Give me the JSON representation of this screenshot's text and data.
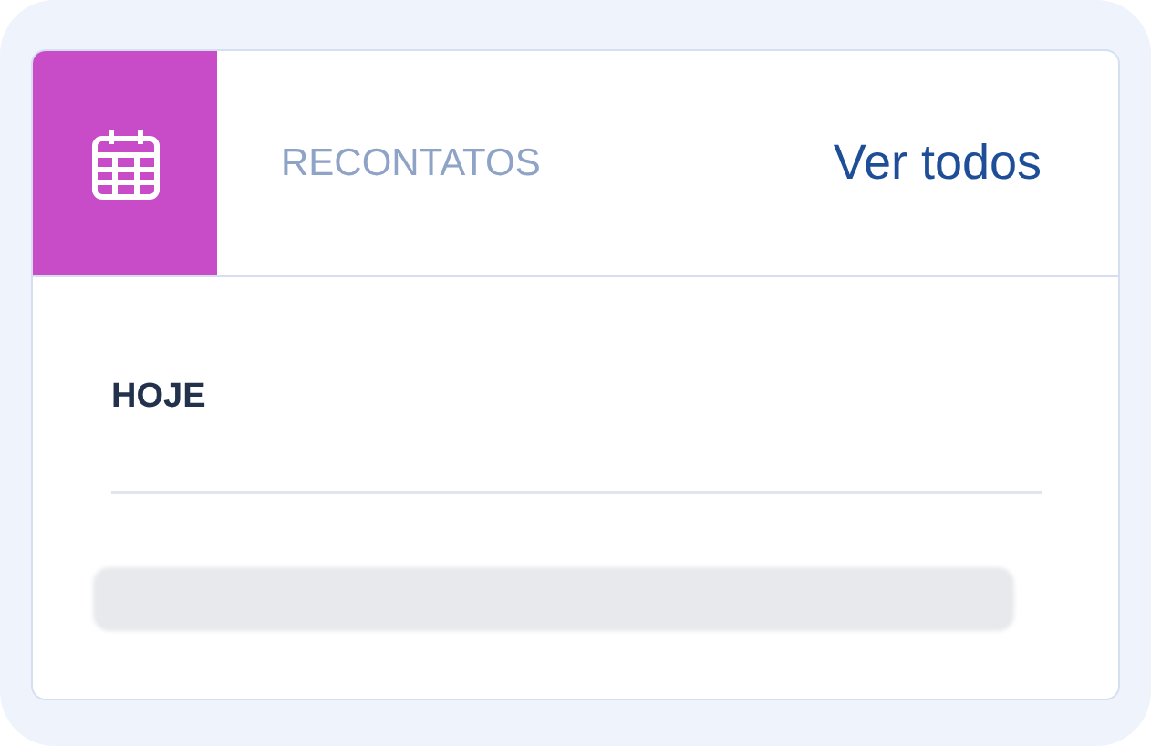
{
  "header": {
    "title": "RECONTATOS",
    "link": "Ver todos"
  },
  "section": {
    "heading": "HOJE",
    "message": {
      "kind": "blurred"
    }
  }
}
